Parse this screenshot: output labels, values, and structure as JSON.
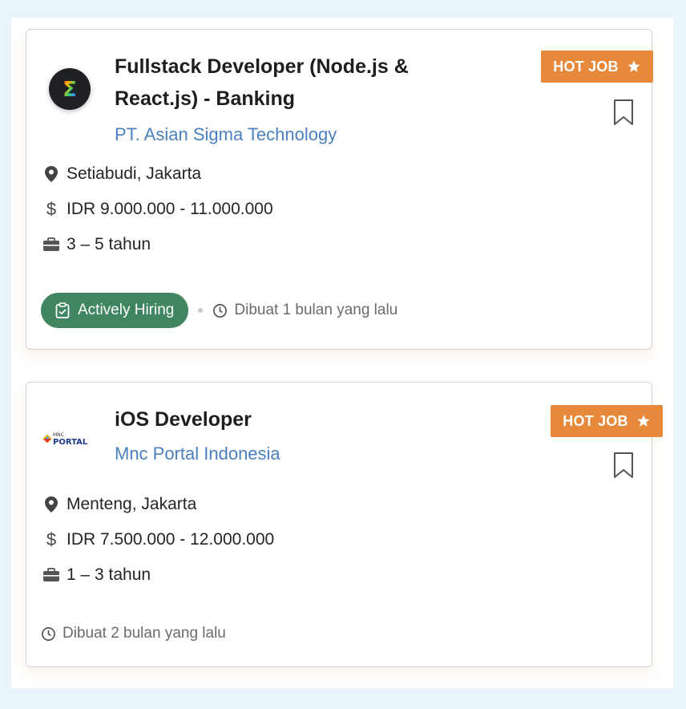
{
  "jobs": [
    {
      "title_line1": "Fullstack Developer (Node.js &",
      "title_line2": "React.js) - Banking",
      "company": "PT. Asian Sigma Technology",
      "badge": "HOT JOB",
      "location": "Setiabudi, Jakarta",
      "salary": "IDR 9.000.000 - 11.000.000",
      "experience": "3 – 5 tahun",
      "status": "Actively Hiring",
      "posted": "Dibuat 1 bulan yang lalu",
      "logo_icon": "sigma-logo",
      "logo_text": "Σ"
    },
    {
      "title": "iOS Developer",
      "company": "Mnc Portal Indonesia",
      "badge": "HOT JOB",
      "location": "Menteng, Jakarta",
      "salary": "IDR 7.500.000 - 12.000.000",
      "experience": "1 – 3 tahun",
      "posted": "Dibuat 2 bulan yang lalu",
      "logo_icon": "mnc-portal-logo",
      "logo_text_small": "MNC",
      "logo_text": "PORTAL"
    }
  ],
  "colors": {
    "hot_badge": "#e6893b",
    "company_link": "#4a80bf",
    "hiring_pill": "#3f8560",
    "background": "#eaf4fb"
  }
}
